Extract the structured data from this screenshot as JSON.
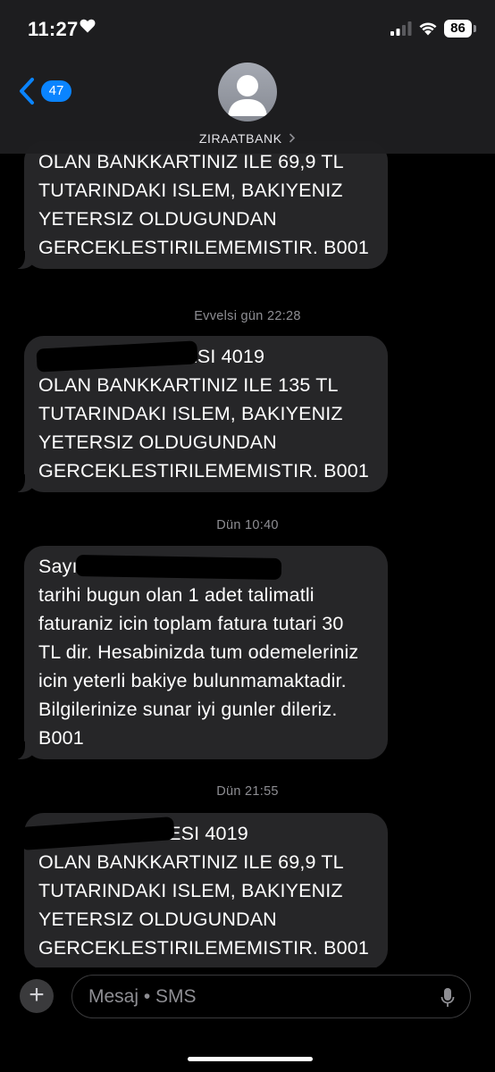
{
  "status_bar": {
    "time": "11:27",
    "battery": "86"
  },
  "header": {
    "back_count": "47",
    "contact_name": "ZIRAATBANK"
  },
  "messages": [
    {
      "lines": [
        "",
        "OLAN BANKKARTINIZ ILE 69,9 TL",
        "TUTARINDAKI ISLEM, BAKIYENIZ",
        "YETERSIZ OLDUGUNDAN",
        "GERCEKLESTIRILEMEMISTIR. B001"
      ]
    },
    {
      "timestamp": "Evvelsi gün 22:28",
      "lines": [
        "SA               , SON 4 HANESI 4019",
        "OLAN BANKKARTINIZ ILE 135 TL",
        "TUTARINDAKI ISLEM, BAKIYENIZ",
        "YETERSIZ OLDUGUNDAN",
        "GERCEKLESTIRILEMEMISTIR. B001"
      ]
    },
    {
      "timestamp": "Dün 10:40",
      "lines": [
        "Sayın                    , son odeme",
        "tarihi bugun olan 1 adet talimatli",
        "faturaniz icin toplam fatura tutari 30",
        "TL dir. Hesabinizda tum odemeleriniz",
        "icin yeterli bakiye bulunmamaktadir.",
        "Bilgilerinize sunar iyi gunler dileriz.",
        "B001"
      ]
    },
    {
      "timestamp": "Dün 21:55",
      "lines": [
        "                      N, SON 4 HANESI 4019",
        "OLAN BANKKARTINIZ ILE 69,9 TL",
        "TUTARINDAKI ISLEM, BAKIYENIZ",
        "YETERSIZ OLDUGUNDAN",
        "GERCEKLESTIRILEMEMISTIR. B001"
      ]
    }
  ],
  "composer": {
    "placeholder": "Mesaj • SMS",
    "plus": "+"
  },
  "colors": {
    "accent": "#0a84ff",
    "bubble": "#262628",
    "background": "#000000"
  },
  "icons": [
    "heart-icon",
    "signal-icon",
    "wifi-icon",
    "back-chevron-icon",
    "person-icon",
    "chevron-right-icon",
    "plus-icon",
    "microphone-icon"
  ]
}
